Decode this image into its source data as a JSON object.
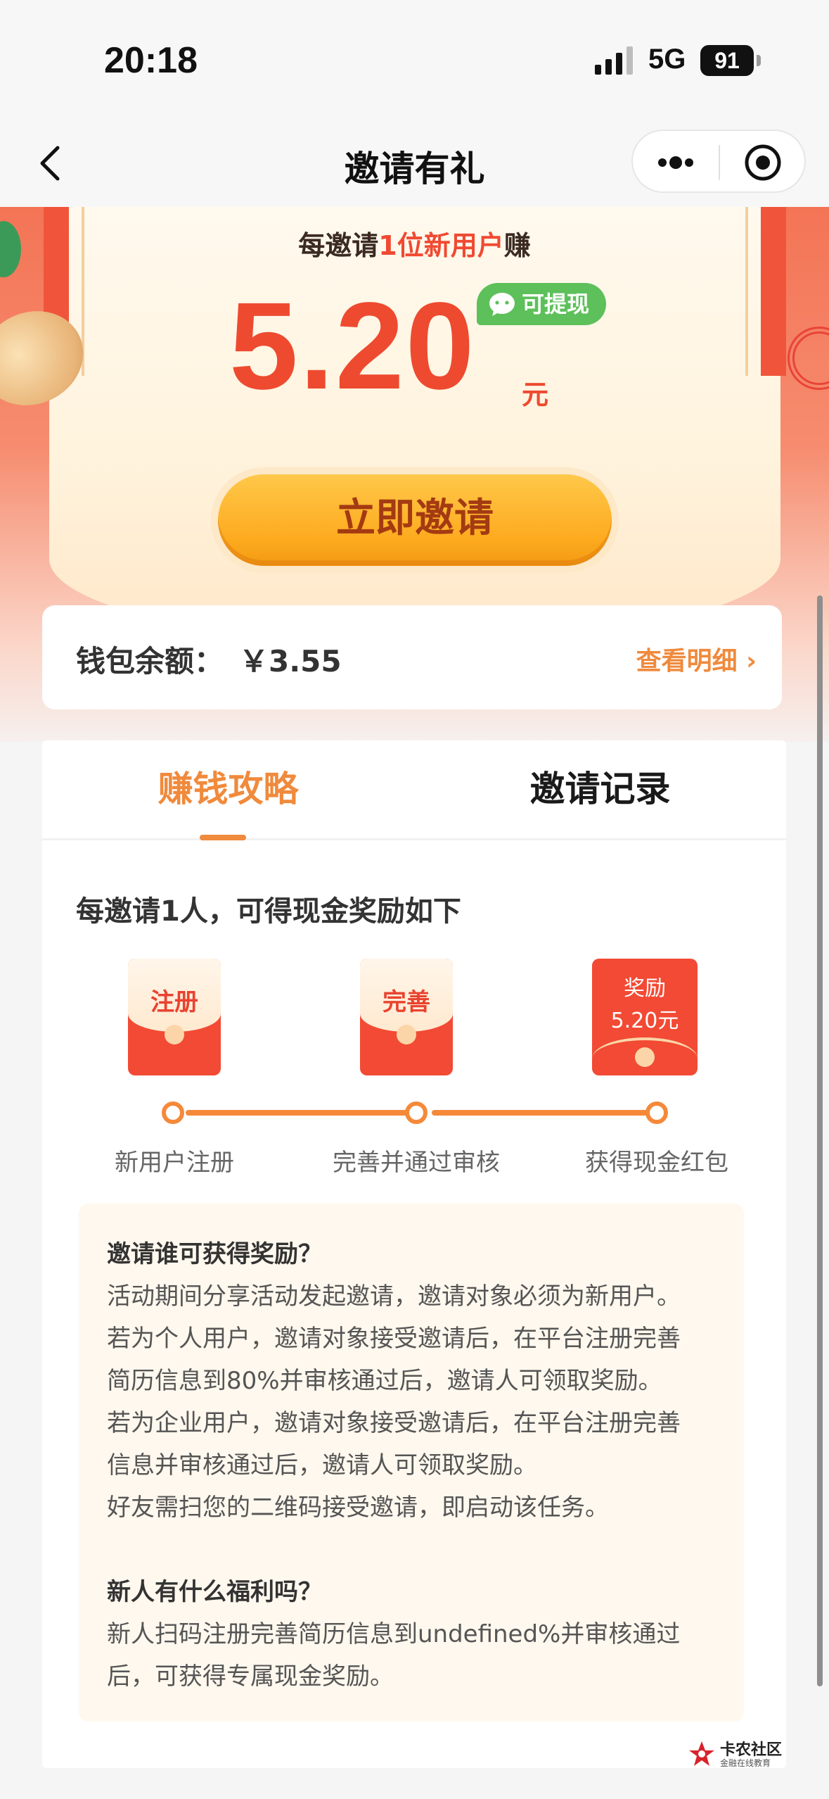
{
  "status_bar": {
    "time": "20:18",
    "network": "5G",
    "battery": "91"
  },
  "nav": {
    "title": "邀请有礼"
  },
  "hero": {
    "subtitle_prefix": "每邀请",
    "subtitle_highlight": "1位新用户",
    "subtitle_suffix": "赚",
    "amount": "5.20",
    "unit": "元",
    "badge": "可提现",
    "invite_button": "立即邀请"
  },
  "wallet": {
    "label": "钱包余额：",
    "value": "￥3.55",
    "detail_link": "查看明细 ›"
  },
  "tabs": [
    {
      "label": "赚钱攻略",
      "active": true
    },
    {
      "label": "邀请记录",
      "active": false
    }
  ],
  "reward": {
    "heading": "每邀请1人，可得现金奖励如下",
    "envelopes": [
      "注册",
      "完善"
    ],
    "reward_envelope": {
      "line1": "奖励",
      "line2": "5.20元"
    },
    "steps": [
      "新用户注册",
      "完善并通过审核",
      "获得现金红包"
    ]
  },
  "faq": {
    "q1": "邀请谁可获得奖励？",
    "a1": [
      "活动期间分享活动发起邀请，邀请对象必须为新用户。",
      "若为个人用户，邀请对象接受邀请后，在平台注册完善",
      "简历信息到80%并审核通过后，邀请人可领取奖励。",
      "若为企业用户，邀请对象接受邀请后，在平台注册完善",
      "信息并审核通过后，邀请人可领取奖励。",
      "好友需扫您的二维码接受邀请，即启动该任务。"
    ],
    "q2": "新人有什么福利吗？",
    "a2": [
      "新人扫码注册完善简历信息到undefined%并审核通过",
      "后，可获得专属现金奖励。"
    ]
  },
  "watermark": {
    "title": "卡农社区",
    "subtitle": "金融在线教育"
  },
  "colors": {
    "accent": "#f08a3c",
    "amount": "#ee4a30",
    "wechat_green": "#5dc05a"
  }
}
